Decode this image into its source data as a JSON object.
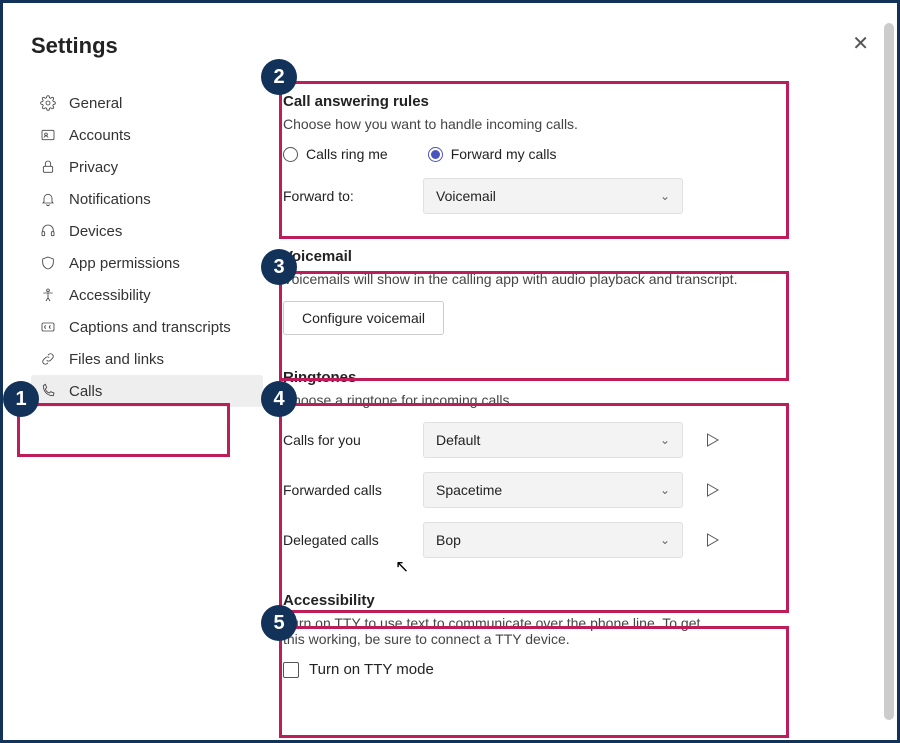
{
  "title": "Settings",
  "nav": [
    {
      "icon": "gear",
      "label": "General"
    },
    {
      "icon": "account",
      "label": "Accounts"
    },
    {
      "icon": "lock",
      "label": "Privacy"
    },
    {
      "icon": "bell",
      "label": "Notifications"
    },
    {
      "icon": "headset",
      "label": "Devices"
    },
    {
      "icon": "shield",
      "label": "App permissions"
    },
    {
      "icon": "accessibility",
      "label": "Accessibility"
    },
    {
      "icon": "cc",
      "label": "Captions and transcripts"
    },
    {
      "icon": "link",
      "label": "Files and links"
    },
    {
      "icon": "phone",
      "label": "Calls"
    }
  ],
  "section1": {
    "title": "Call answering rules",
    "desc": "Choose how you want to handle incoming calls.",
    "opt1": "Calls ring me",
    "opt2": "Forward my calls",
    "forward_label": "Forward to:",
    "forward_value": "Voicemail"
  },
  "section2": {
    "title": "Voicemail",
    "desc": "Voicemails will show in the calling app with audio playback and transcript.",
    "button": "Configure voicemail"
  },
  "section3": {
    "title": "Ringtones",
    "desc": "Choose a ringtone for incoming calls",
    "rows": [
      {
        "label": "Calls for you",
        "value": "Default"
      },
      {
        "label": "Forwarded calls",
        "value": "Spacetime"
      },
      {
        "label": "Delegated calls",
        "value": "Bop"
      }
    ]
  },
  "section4": {
    "title": "Accessibility",
    "desc": "Turn on TTY to use text to communicate over the phone line. To get this working, be sure to connect a TTY device.",
    "checkbox_label": "Turn on TTY mode"
  },
  "badges": [
    "1",
    "2",
    "3",
    "4",
    "5"
  ]
}
